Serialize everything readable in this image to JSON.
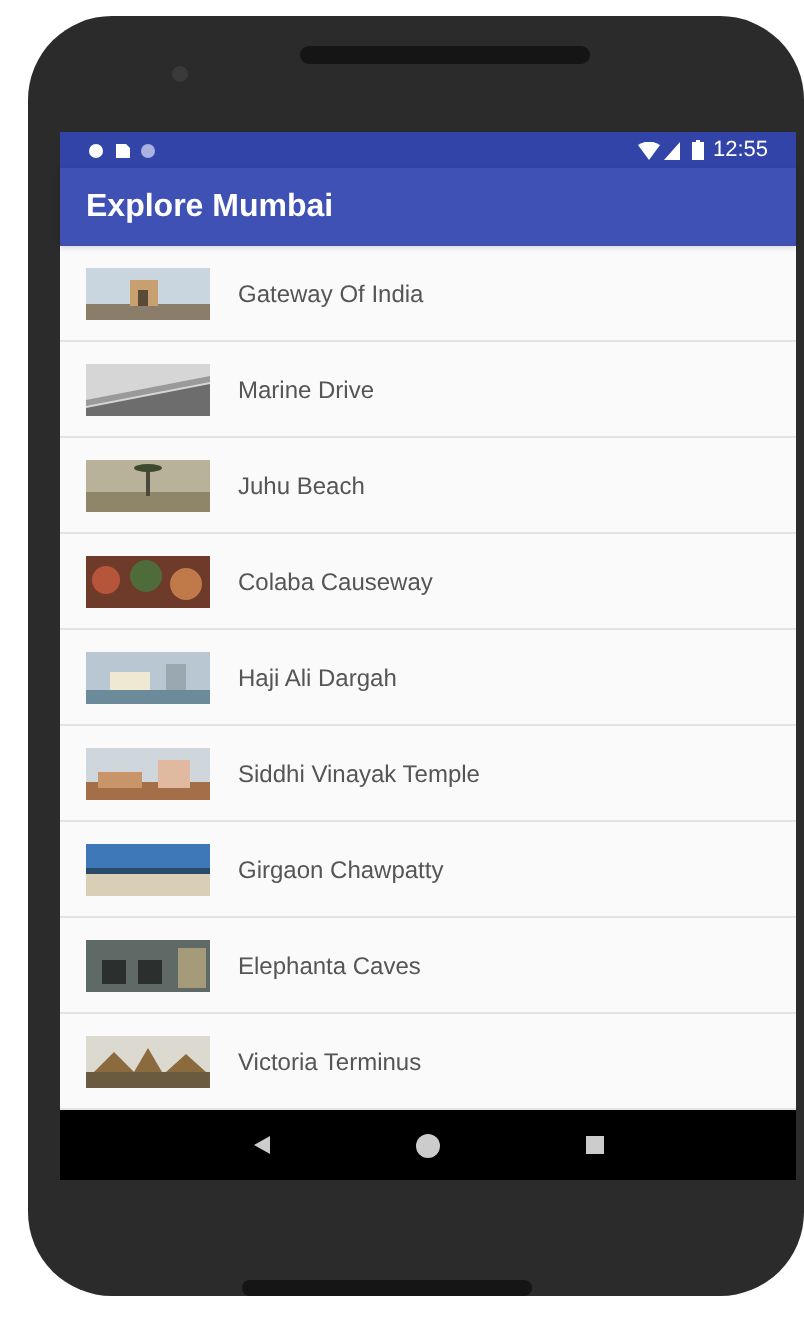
{
  "status_bar": {
    "time": "12:55"
  },
  "app_bar": {
    "title": "Explore Mumbai"
  },
  "places": [
    {
      "title": "Gateway Of India"
    },
    {
      "title": "Marine Drive"
    },
    {
      "title": "Juhu Beach"
    },
    {
      "title": "Colaba Causeway"
    },
    {
      "title": "Haji Ali Dargah"
    },
    {
      "title": "Siddhi Vinayak Temple"
    },
    {
      "title": "Girgaon Chawpatty"
    },
    {
      "title": "Elephanta Caves"
    },
    {
      "title": "Victoria Terminus"
    }
  ]
}
